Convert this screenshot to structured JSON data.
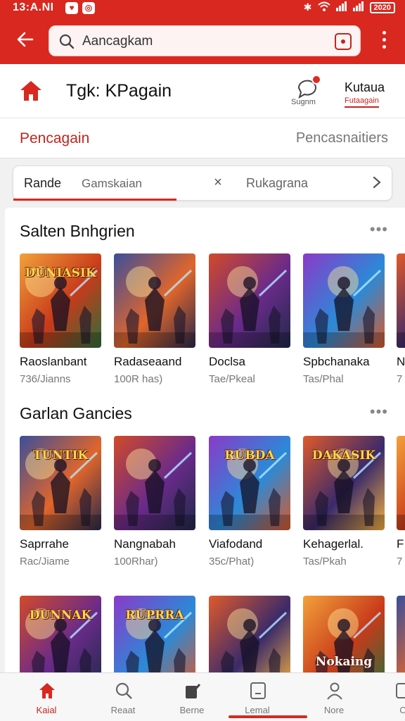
{
  "status_bar": {
    "time": "13:A.NI",
    "battery": "2020"
  },
  "search": {
    "text": "Aancagkam"
  },
  "header": {
    "title": "Tgk: KPagain",
    "notification_label": "Sugnm",
    "account_title": "Kutaua",
    "account_sub": "Futaagain"
  },
  "tabs": {
    "left": "Pencagain",
    "right": "Pencasnaitiers"
  },
  "filter": {
    "chip": "Rande",
    "chip_value": "Gamskaian",
    "clear": "×",
    "category": "Rukagrana"
  },
  "sections": [
    {
      "title": "Salten Bnhgrien",
      "items": [
        {
          "name": "Raoslanbant",
          "sub": "736/Jianns"
        },
        {
          "name": "Radaseaand",
          "sub": "100R has)"
        },
        {
          "name": "Doclsa",
          "sub": "Tae/Pkeal"
        },
        {
          "name": "Spbchanaka",
          "sub": "Tas/Phal"
        },
        {
          "name": "N",
          "sub": "7"
        }
      ]
    },
    {
      "title": "Garlan Gancies",
      "items": [
        {
          "name": "Saprrahe",
          "sub": "Rac/Jiame"
        },
        {
          "name": "Nangnabah",
          "sub": "100Rhar)"
        },
        {
          "name": "Viafodand",
          "sub": "35c/Phat)"
        },
        {
          "name": "Kehagerlal.",
          "sub": "Tas/Pkah"
        },
        {
          "name": "F",
          "sub": "7"
        }
      ]
    },
    {
      "title": "",
      "items": [
        {
          "name": "",
          "sub": ""
        },
        {
          "name": "",
          "sub": ""
        },
        {
          "name": "",
          "sub": ""
        },
        {
          "name": "",
          "sub": ""
        },
        {
          "name": "",
          "sub": ""
        }
      ]
    }
  ],
  "tile_art": {
    "row1": [
      "DUNIASIK",
      "",
      "",
      "",
      ""
    ],
    "row2": [
      "TUNTIK",
      "",
      "RUBDA",
      "DAKASIK",
      ""
    ],
    "row3": [
      "DUNNAK",
      "RUPRRA",
      "",
      "Nokaing",
      ""
    ]
  },
  "bottom_nav": [
    {
      "label": "Kaial",
      "icon": "home-icon",
      "active": true
    },
    {
      "label": "Reaat",
      "icon": "search-icon",
      "active": false
    },
    {
      "label": "Berne",
      "icon": "edit-icon",
      "active": false
    },
    {
      "label": "Lemal",
      "icon": "tablet-icon",
      "active": false
    },
    {
      "label": "Nore",
      "icon": "profile-icon",
      "active": false
    },
    {
      "label": "C",
      "icon": "grid-icon",
      "active": false
    }
  ],
  "colors": {
    "accent": "#d9281f",
    "accent_dark": "#c0261e"
  }
}
